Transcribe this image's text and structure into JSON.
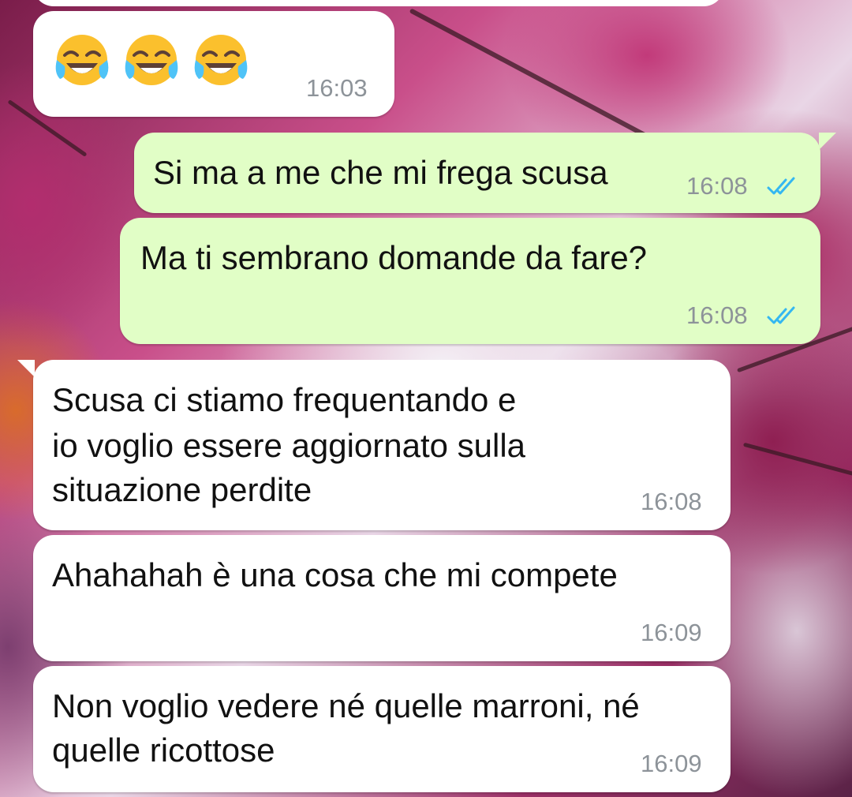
{
  "messages": [
    {
      "id": "m1",
      "direction": "incoming",
      "emoji": [
        "face-with-tears-of-joy-icon",
        "face-with-tears-of-joy-icon",
        "face-with-tears-of-joy-icon"
      ],
      "time": "16:03"
    },
    {
      "id": "m2",
      "direction": "outgoing",
      "text": "Si ma a me che mi frega scusa",
      "time": "16:08",
      "status": "read"
    },
    {
      "id": "m3",
      "direction": "outgoing",
      "text": "Ma ti sembrano domande da fare?",
      "time": "16:08",
      "status": "read"
    },
    {
      "id": "m4",
      "direction": "incoming",
      "lines": [
        "Scusa ci stiamo frequentando e",
        "io voglio essere aggiornato sulla",
        "situazione perdite"
      ],
      "time": "16:08"
    },
    {
      "id": "m5",
      "direction": "incoming",
      "text": "Ahahahah è una cosa che mi compete",
      "time": "16:09"
    },
    {
      "id": "m6",
      "direction": "incoming",
      "lines": [
        "Non voglio vedere né quelle marroni, né",
        "quelle ricottose"
      ],
      "time": "16:09"
    }
  ],
  "colors": {
    "incoming_bubble": "#ffffff",
    "outgoing_bubble": "#e1fec6",
    "timestamp": "#8d9399",
    "read_ticks": "#34b7f1"
  }
}
